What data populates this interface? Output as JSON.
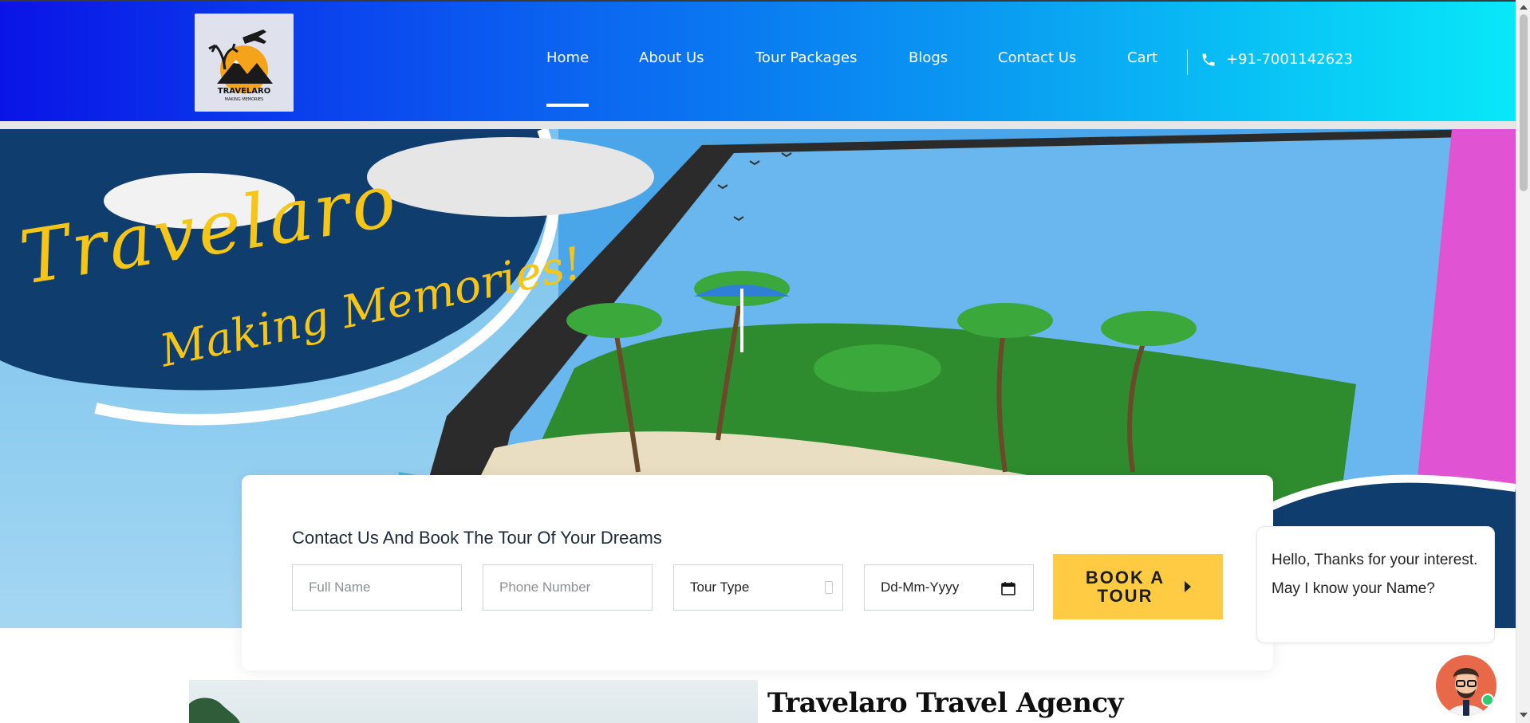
{
  "header": {
    "logo": {
      "brand_text": "TRAVELARO",
      "tagline_text": "MAKING MEMORIES"
    },
    "nav": [
      {
        "label": "Home",
        "active": true
      },
      {
        "label": "About Us"
      },
      {
        "label": "Tour Packages"
      },
      {
        "label": "Blogs"
      },
      {
        "label": "Contact Us"
      },
      {
        "label": "Cart"
      }
    ],
    "phone": {
      "icon": "phone-icon",
      "number": "+91-7001142623"
    },
    "gradient_colors": [
      "#0a14e6",
      "#08e8f8"
    ]
  },
  "hero": {
    "title": "Travelaro",
    "tagline": "Making Memories!",
    "title_color": "#f5c518"
  },
  "booking": {
    "heading": "Contact Us And Book The Tour Of Your Dreams",
    "full_name_placeholder": "Full Name",
    "phone_placeholder": "Phone Number",
    "tour_type_value": "Tour Type",
    "date_placeholder": "Dd-Mm-Yyyy",
    "book_button_label": "BOOK A TOUR",
    "button_color": "#ffcb42"
  },
  "chat": {
    "message": "Hello, Thanks for your interest. May I know your Name?",
    "status_color": "#2ecc71"
  },
  "about": {
    "title": "Travelaro Travel Agency"
  }
}
